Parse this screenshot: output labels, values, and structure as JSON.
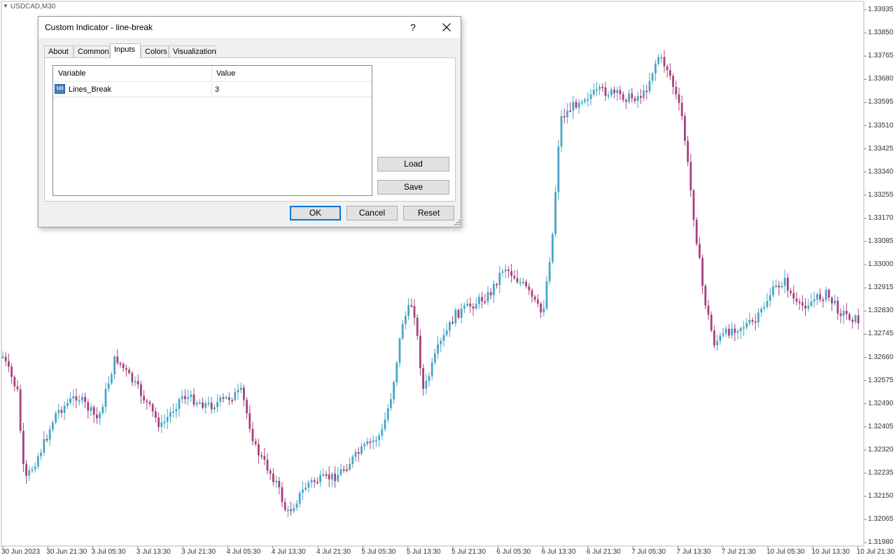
{
  "chart": {
    "symbol": "USDCAD,M30",
    "bullish_color": "#46a6c7",
    "bearish_color": "#a8407a",
    "price_labels": [
      "1.33935",
      "1.33850",
      "1.33765",
      "1.33680",
      "1.33595",
      "1.33510",
      "1.33425",
      "1.33340",
      "1.33255",
      "1.33170",
      "1.33085",
      "1.33000",
      "1.32915",
      "1.32830",
      "1.32745",
      "1.32660",
      "1.32575",
      "1.32490",
      "1.32405",
      "1.32320",
      "1.32235",
      "1.32150",
      "1.32065",
      "1.31980"
    ],
    "time_labels": [
      "30 Jun 2023",
      "30 Jun 21:30",
      "3 Jul 05:30",
      "3 Jul 13:30",
      "3 Jul 21:30",
      "4 Jul 05:30",
      "4 Jul 13:30",
      "4 Jul 21:30",
      "5 Jul 05:30",
      "5 Jul 13:30",
      "5 Jul 21:30",
      "6 Jul 05:30",
      "6 Jul 13:30",
      "6 Jul 21:30",
      "7 Jul 05:30",
      "7 Jul 13:30",
      "7 Jul 21:30",
      "10 Jul 05:30",
      "10 Jul 13:30",
      "10 Jul 21:30"
    ]
  },
  "dialog": {
    "title": "Custom Indicator - line-break",
    "help": "?",
    "tabs": [
      "About",
      "Common",
      "Inputs",
      "Colors",
      "Visualization"
    ],
    "active_tab": "Inputs",
    "grid": {
      "col_variable": "Variable",
      "col_value": "Value",
      "rows": [
        {
          "icon_text": "123",
          "variable": "Lines_Break",
          "value": "3"
        }
      ]
    },
    "load_label": "Load",
    "save_label": "Save",
    "ok_label": "OK",
    "cancel_label": "Cancel",
    "reset_label": "Reset"
  }
}
